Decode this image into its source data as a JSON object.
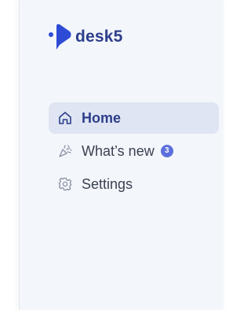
{
  "app": {
    "logo_text": "desk5",
    "brand_color": "#2c3e8c",
    "logo_mark_color": "#2e4bd6"
  },
  "nav": {
    "items": [
      {
        "label": "Home",
        "icon": "home-icon",
        "active": true
      },
      {
        "label": "What’s new",
        "icon": "party-popper-icon",
        "badge": "3",
        "active": false
      },
      {
        "label": "Settings",
        "icon": "gear-icon",
        "active": false
      }
    ]
  }
}
